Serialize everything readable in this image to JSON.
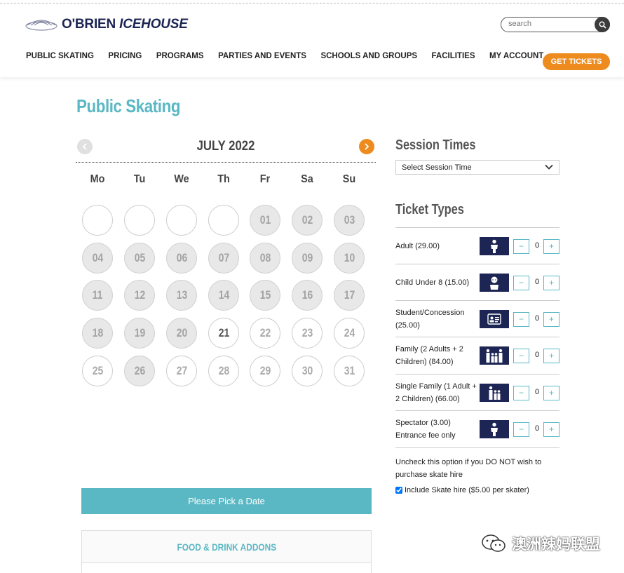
{
  "brand": {
    "name_part1": "O'BRIEN",
    "name_part2": "ICEHOUSE"
  },
  "search": {
    "placeholder": "search"
  },
  "nav": {
    "items": [
      "PUBLIC SKATING",
      "PRICING",
      "PROGRAMS",
      "PARTIES AND EVENTS",
      "SCHOOLS AND GROUPS",
      "FACILITIES",
      "MY ACCOUNT"
    ],
    "cta": "GET TICKETS"
  },
  "page": {
    "title": "Public Skating"
  },
  "calendar": {
    "month_label": "JULY 2022",
    "weekdays": [
      "Mo",
      "Tu",
      "We",
      "Th",
      "Fr",
      "Sa",
      "Su"
    ],
    "leading_blanks": 4,
    "days": [
      "01",
      "02",
      "03",
      "04",
      "05",
      "06",
      "07",
      "08",
      "09",
      "10",
      "11",
      "12",
      "13",
      "14",
      "15",
      "16",
      "17",
      "18",
      "19",
      "20",
      "21",
      "22",
      "23",
      "24",
      "25",
      "26",
      "27",
      "28",
      "29",
      "30",
      "31"
    ],
    "unavailable_days": [
      "01",
      "02",
      "03",
      "04",
      "05",
      "06",
      "07",
      "08",
      "09",
      "10",
      "11",
      "12",
      "13",
      "14",
      "15",
      "16",
      "17",
      "18",
      "19",
      "20",
      "26"
    ],
    "today": "21"
  },
  "pick_date_button": "Please Pick a Date",
  "food_addons": {
    "title": "FOOD & DRINK ADDONS"
  },
  "session_times": {
    "title": "Session Times",
    "selected": "Select Session Time"
  },
  "ticket_types": {
    "title": "Ticket Types",
    "items": [
      {
        "label": "Adult (29.00)",
        "icon": "adult-icon",
        "qty": "0"
      },
      {
        "label": "Child Under 8 (15.00)",
        "icon": "child-icon",
        "qty": "0"
      },
      {
        "label": "Student/Concession (25.00)",
        "icon": "id-card-icon",
        "qty": "0"
      },
      {
        "label": "Family (2 Adults + 2 Children) (84.00)",
        "icon": "family-icon",
        "qty": "0"
      },
      {
        "label": "Single Family (1 Adult + 2 Children) (66.00)",
        "icon": "single-family-icon",
        "qty": "0"
      },
      {
        "label": "Spectator (3.00) Entrance fee only",
        "icon": "spectator-icon",
        "qty": "0"
      }
    ],
    "minus": "−",
    "plus": "+"
  },
  "skate_hire": {
    "note": "Uncheck this option if you DO NOT wish to purchase skate hire",
    "checkbox_label": "Include Skate hire ($5.00 per skater)",
    "checked": true
  },
  "watermark": {
    "text": "澳洲辣妈联盟"
  },
  "colors": {
    "accent": "#5ab8c4",
    "orange": "#ed8b1f",
    "navy": "#1c2553"
  }
}
